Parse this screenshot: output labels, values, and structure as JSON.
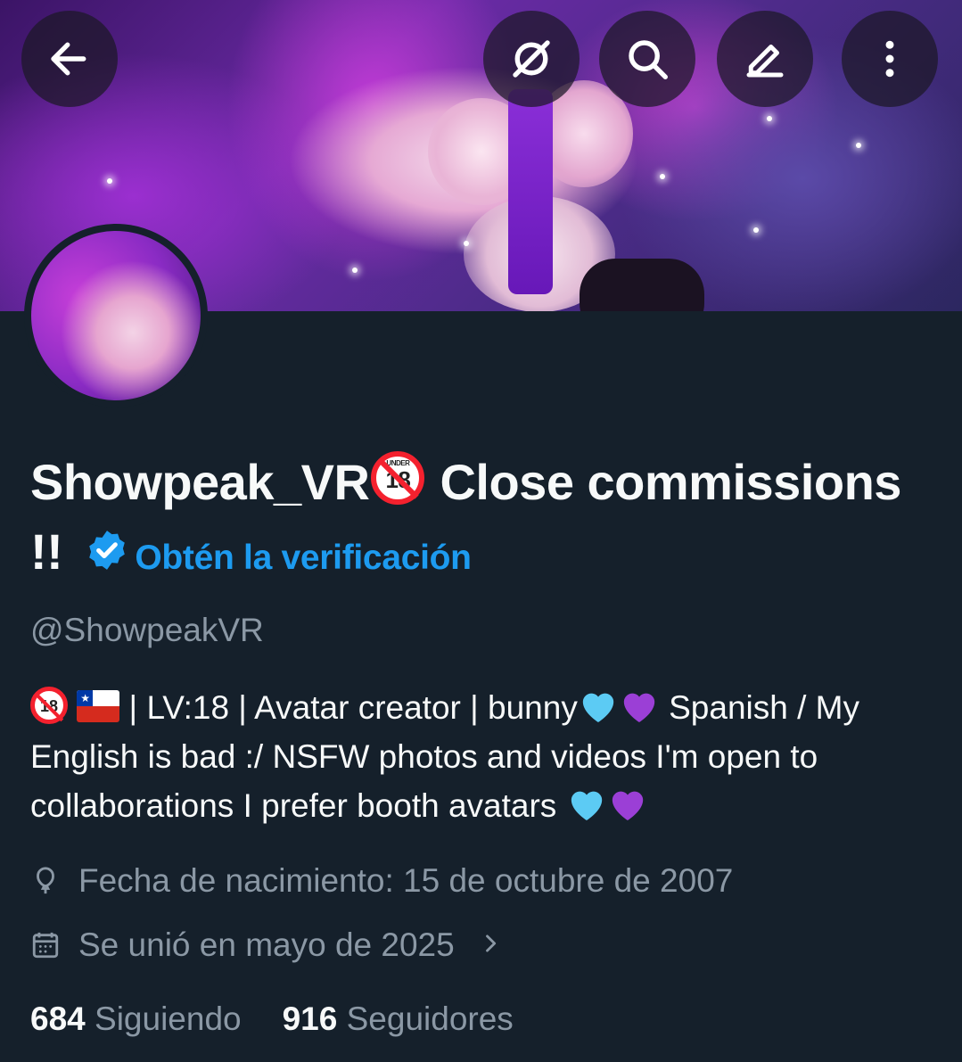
{
  "header": {
    "back_icon": "arrow-left-icon",
    "grok_icon": "grok-slash-icon",
    "search_icon": "search-icon",
    "edit_icon": "edit-pencil-icon",
    "more_icon": "more-vertical-icon"
  },
  "profile": {
    "name_part1": "Showpeak_VR",
    "name_badge_label": "UNDER",
    "name_badge_number": "18",
    "name_part2": " Close commissions !!",
    "get_verified": "Obtén la verificación",
    "handle": "@ShowpeakVR",
    "bio_badge_number": "18",
    "bio_line1": " | LV:18 | Avatar creator | bunny",
    "bio_line1_after": "  Spanish / My English is bad :/  NSFW photos and videos I'm open to collaborations    I prefer booth avatars ",
    "birthdate": "Fecha de nacimiento: 15 de octubre de 2007",
    "joined": "Se unió en mayo de 2025",
    "following_count": "684",
    "following_label": "Siguiendo",
    "followers_count": "916",
    "followers_label": "Seguidores"
  },
  "colors": {
    "background": "#15202b",
    "accent": "#1d9bf0",
    "muted_text": "#8b98a5",
    "primary_text": "#f7f9f9"
  }
}
